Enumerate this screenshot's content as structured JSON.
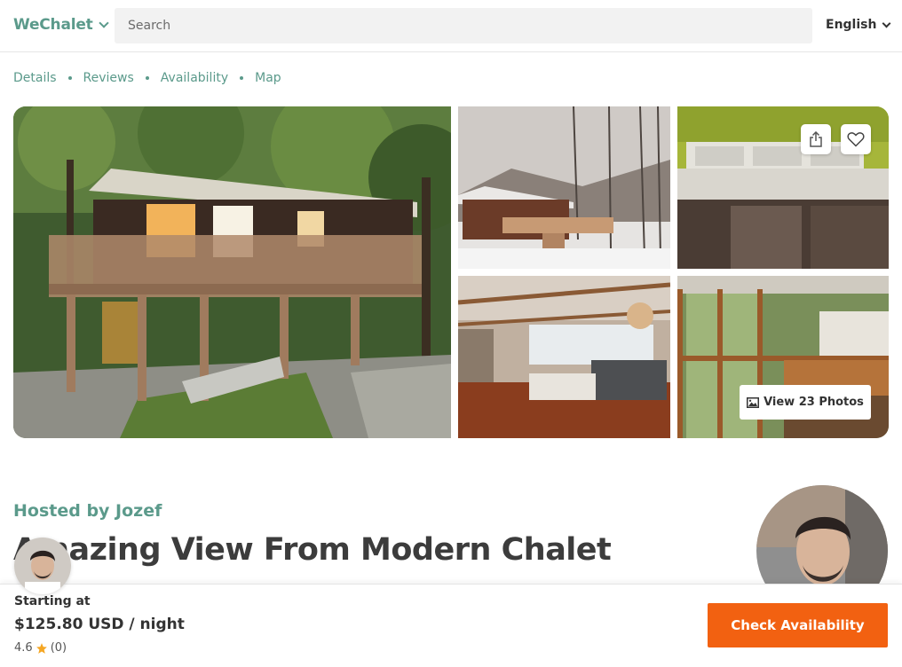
{
  "header": {
    "brand": "WeChalet",
    "search_placeholder": "Search",
    "language": "English"
  },
  "subnav": {
    "items": [
      {
        "label": "Details"
      },
      {
        "label": "Reviews"
      },
      {
        "label": "Availability"
      },
      {
        "label": "Map"
      }
    ]
  },
  "gallery": {
    "view_photos_label": "View 23 Photos"
  },
  "listing": {
    "hosted_by": "Hosted by Jozef",
    "title": "Amazing View From Modern Chalet"
  },
  "booking": {
    "starting_label": "Starting at",
    "price": "$125.80 USD / night",
    "rating": "4.6",
    "review_count": "(0)",
    "cta_label": "Check Availability"
  },
  "colors": {
    "brand": "#5b9a8b",
    "cta": "#f26111",
    "star": "#f5a623"
  }
}
